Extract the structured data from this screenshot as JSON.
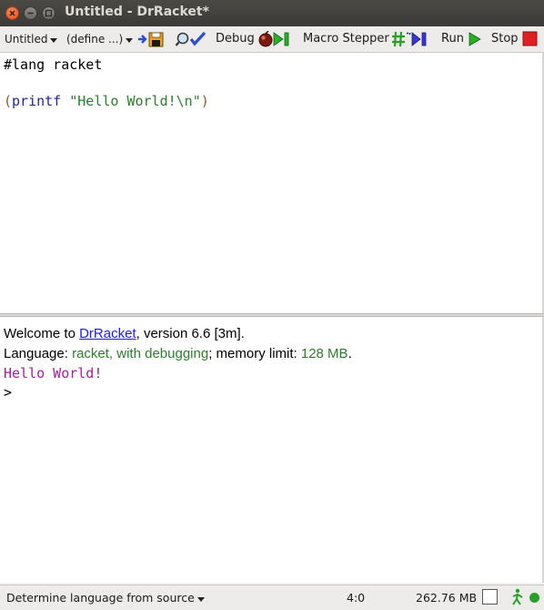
{
  "window": {
    "title": "Untitled - DrRacket*"
  },
  "toolbar": {
    "file_menu": "Untitled",
    "define_menu": "(define ...)",
    "debug_label": "Debug",
    "macro_stepper_label": "Macro Stepper",
    "run_label": "Run",
    "stop_label": "Stop"
  },
  "definitions": {
    "line1": "#lang racket",
    "line2_open_paren": "(",
    "line2_func": "printf",
    "line2_space": " ",
    "line2_string": "\"Hello World!\\n\"",
    "line2_close_paren": ")"
  },
  "interactions": {
    "welcome_prefix": "Welcome to ",
    "welcome_link": "DrRacket",
    "welcome_suffix": ", version 6.6 [3m].",
    "language_prefix": "Language: ",
    "language_value": "racket, with debugging",
    "language_mid": "; memory limit: ",
    "memory_limit": "128 MB",
    "language_end": ".",
    "output": "Hello World!",
    "prompt": ">"
  },
  "status": {
    "language_selector": "Determine language from source",
    "position": "4:0",
    "memory": "262.76 MB"
  },
  "colors": {
    "keyword": "#26268c",
    "string": "#2b7d2b",
    "output": "#a020a0",
    "stop": "#e02020",
    "run": "#28b028"
  }
}
